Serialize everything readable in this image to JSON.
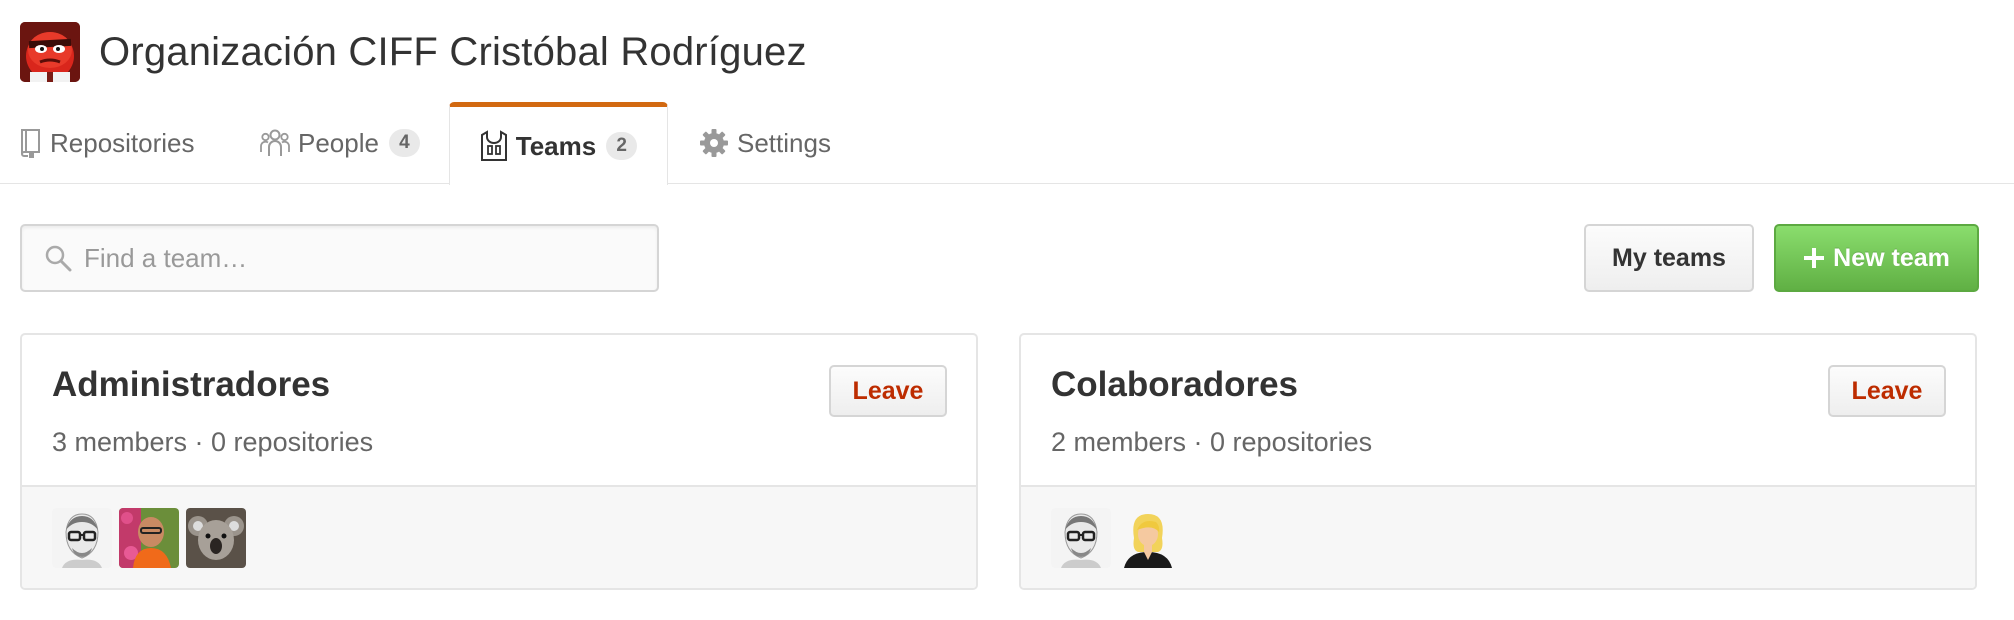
{
  "org": {
    "title": "Organización CIFF Cristóbal Rodríguez",
    "avatar_icon": "red-angry-character-avatar"
  },
  "tabs": [
    {
      "id": "repositories",
      "label": "Repositories",
      "icon": "repo-icon",
      "selected": false
    },
    {
      "id": "people",
      "label": "People",
      "count": "4",
      "icon": "people-icon",
      "selected": false
    },
    {
      "id": "teams",
      "label": "Teams",
      "count": "2",
      "icon": "jersey-icon",
      "selected": true
    },
    {
      "id": "settings",
      "label": "Settings",
      "icon": "gear-icon",
      "selected": false
    }
  ],
  "toolbar": {
    "search_placeholder": "Find a team…",
    "my_teams_label": "My teams",
    "new_team_label": "New team"
  },
  "teams": [
    {
      "name": "Administradores",
      "meta": "3 members · 0 repositories",
      "leave_label": "Leave",
      "members": [
        "member-glasses-man",
        "member-orange-shirt",
        "member-koala"
      ]
    },
    {
      "name": "Colaboradores",
      "meta": "2 members · 0 repositories",
      "leave_label": "Leave",
      "members": [
        "member-glasses-man",
        "member-blonde-woman"
      ]
    }
  ],
  "colors": {
    "selected_tab_accent": "#d26911",
    "new_team_green": "#60b044",
    "leave_red": "#bd2c00"
  }
}
